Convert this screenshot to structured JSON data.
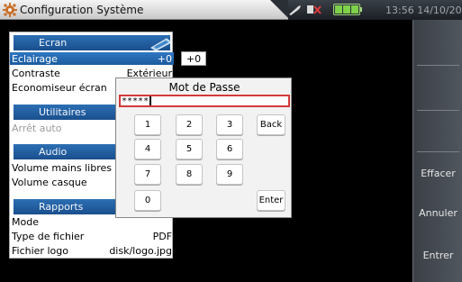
{
  "app": {
    "title": "Configuration Système",
    "clock": "13:56 14/10/2016"
  },
  "softkeys": [
    "",
    "",
    "",
    "Effacer",
    "Annuler",
    "Entrer"
  ],
  "sections": {
    "ecran": "Ecran",
    "utilitaires": "Utilitaires",
    "audio": "Audio",
    "rapports": "Rapports"
  },
  "rows": {
    "eclairage": {
      "label": "Eclairage",
      "value": "+0"
    },
    "contraste": {
      "label": "Contraste",
      "value": "Extérieur"
    },
    "economiseur": {
      "label": "Economiseur écran",
      "value": ""
    },
    "arret_auto": {
      "label": "Arrêt auto",
      "value": ""
    },
    "volume_mains": {
      "label": "Volume mains libres",
      "value": ""
    },
    "volume_casque": {
      "label": "Volume casque",
      "value": ""
    },
    "mode": {
      "label": "Mode",
      "value": ""
    },
    "type_fichier": {
      "label": "Type de fichier",
      "value": "PDF"
    },
    "fichier_logo": {
      "label": "Fichier logo",
      "value": "disk/logo.jpg"
    }
  },
  "side_value": "+0",
  "dialog": {
    "title": "Mot de Passe",
    "password_mask": "*****",
    "keys": {
      "k1": "1",
      "k2": "2",
      "k3": "3",
      "back": "Back",
      "k4": "4",
      "k5": "5",
      "k6": "6",
      "k7": "7",
      "k8": "8",
      "k9": "9",
      "k0": "0",
      "enter": "Enter"
    }
  },
  "colors": {
    "accent": "#1d5c9e",
    "field_border": "#d23a3a",
    "battery": "#7fd04a"
  }
}
